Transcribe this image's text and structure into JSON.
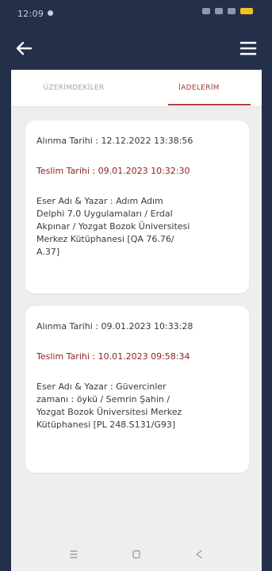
{
  "status_bar": {
    "time": "12:09"
  },
  "tabs": [
    {
      "label": "ÜZERİMDEKİLER"
    },
    {
      "label": "İADELERİM"
    }
  ],
  "records": [
    {
      "alinma": "Alınma Tarihi : 12.12.2022 13:38:56",
      "teslim": "Teslim Tarihi : 09.01.2023 10:32:30",
      "eser_lines": [
        "Eser Adı & Yazar : Adım Adım",
        "Delphi 7.0 Uygulamaları / Erdal",
        "Akpınar / Yozgat Bozok Üniversitesi",
        "Merkez Kütüphanesi  [QA 76.76/",
        "A.37]"
      ]
    },
    {
      "alinma": "Alınma Tarihi : 09.01.2023 10:33:28",
      "teslim": "Teslim Tarihi : 10.01.2023 09:58:34",
      "eser_lines": [
        "Eser Adı & Yazar : Güvercinler",
        "zamanı : öykü / Semrin Şahin /",
        "Yozgat Bozok Üniversitesi Merkez",
        "Kütüphanesi  [PL 248.S131/G93]"
      ]
    }
  ],
  "colors": {
    "background": "#24304a",
    "accent_red": "#b33c3c",
    "teslim_text": "#8b2323",
    "card_bg": "#ffffff",
    "content_bg": "#eeeeef"
  },
  "icons": {
    "back": "arrow-left-icon",
    "menu": "hamburger-menu-icon",
    "nav_recent": "recent-apps-icon",
    "nav_home": "home-icon",
    "nav_back": "triangle-back-icon"
  }
}
